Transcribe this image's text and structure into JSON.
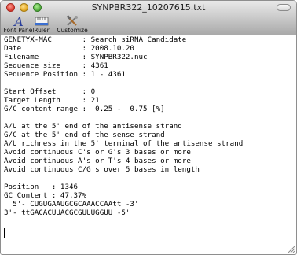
{
  "window": {
    "title": "SYNPBR322_10207615.txt"
  },
  "toolbar": {
    "items": [
      {
        "label": "Font Panel",
        "icon": "font-panel-icon"
      },
      {
        "label": "Ruler",
        "icon": "ruler-icon"
      },
      {
        "label": "Customize",
        "icon": "customize-icon"
      }
    ]
  },
  "document": {
    "lines": [
      "GENETYX-MAC       : Search siRNA Candidate",
      "Date              : 2008.10.20",
      "Filename          : SYNPBR322.nuc",
      "Sequence size     : 4361",
      "Sequence Position : 1 - 4361",
      "",
      "Start Offset      : 0",
      "Target Length     : 21",
      "G/C content range :  0.25 -  0.75 [%]",
      "",
      "A/U at the 5' end of the antisense strand",
      "G/C at the 5' end of the sense strand",
      "A/U richness in the 5' terminal of the antisense strand",
      "Avoid continuous C's or G's 3 bases or more",
      "Avoid continuous A's or T's 4 bases or more",
      "Avoid continuous C/G's over 5 bases in length",
      "",
      "Position   : 1346",
      "GC Content : 47.37%",
      "  5'- CUGUGAAUGCGCAAACCAAtt -3'",
      "3'- ttGACACUUACGCGUUUGGUU -5'"
    ]
  }
}
